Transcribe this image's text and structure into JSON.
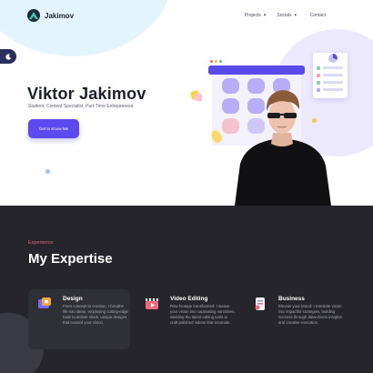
{
  "nav": {
    "brand": "Jakimov",
    "links": [
      {
        "label": "Projects",
        "has_dropdown": true
      },
      {
        "label": "Socials",
        "has_dropdown": true
      }
    ],
    "contact": "Contact"
  },
  "hero": {
    "name": "Viktor Jakimov",
    "subtitle": "Student, Content Specialist, Part-Time Entrepreneur.",
    "cta": "Get to Know Me"
  },
  "expertise": {
    "eyebrow": "Experience",
    "title": "My Expertise",
    "items": [
      {
        "title": "Design",
        "desc": "From concept to creation, I breathe life into ideas, employing cutting-edge tools to deliver sleek, unique designs that exceed your vision.",
        "icon": "design-icon"
      },
      {
        "title": "Video Editing",
        "desc": "Raw footage transformed: I weave your vision into captivating narratives, wielding the latest editing tools to craft polished videos that resonate.",
        "icon": "video-icon"
      },
      {
        "title": "Business",
        "desc": "Elevate your brand: I translate vision into impactful strategies, building success through data-driven insights and creative execution.",
        "icon": "business-icon"
      }
    ]
  },
  "colors": {
    "accent": "#5d49f0",
    "eyebrow": "#e6607a",
    "dark_bg": "#25252b"
  }
}
